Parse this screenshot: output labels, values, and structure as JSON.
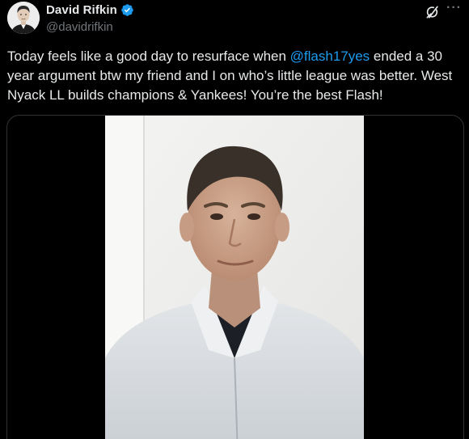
{
  "author": {
    "display_name": "David Rifkin",
    "handle": "@davidrifkin",
    "verified": true,
    "avatar_icon": "profile-photo-icon"
  },
  "actions": {
    "grok_icon": "grok-icon",
    "more_icon": "more-options-icon",
    "more_label": "···"
  },
  "tweet": {
    "text_before": "Today feels like a good day to resurface when ",
    "mention": "@flash17yes",
    "text_after": " ended a 30 year argument btw my friend and I on who’s little league was better. West Nyack LL builds champions & Yankees! You’re the best Flash!"
  },
  "media": {
    "type": "video",
    "thumbnail_icon": "video-thumbnail"
  },
  "colors": {
    "background": "#000000",
    "text": "#e7e9ea",
    "secondary": "#71767b",
    "link": "#1d9bf0",
    "border": "#2f3336",
    "verified": "#1d9bf0"
  }
}
